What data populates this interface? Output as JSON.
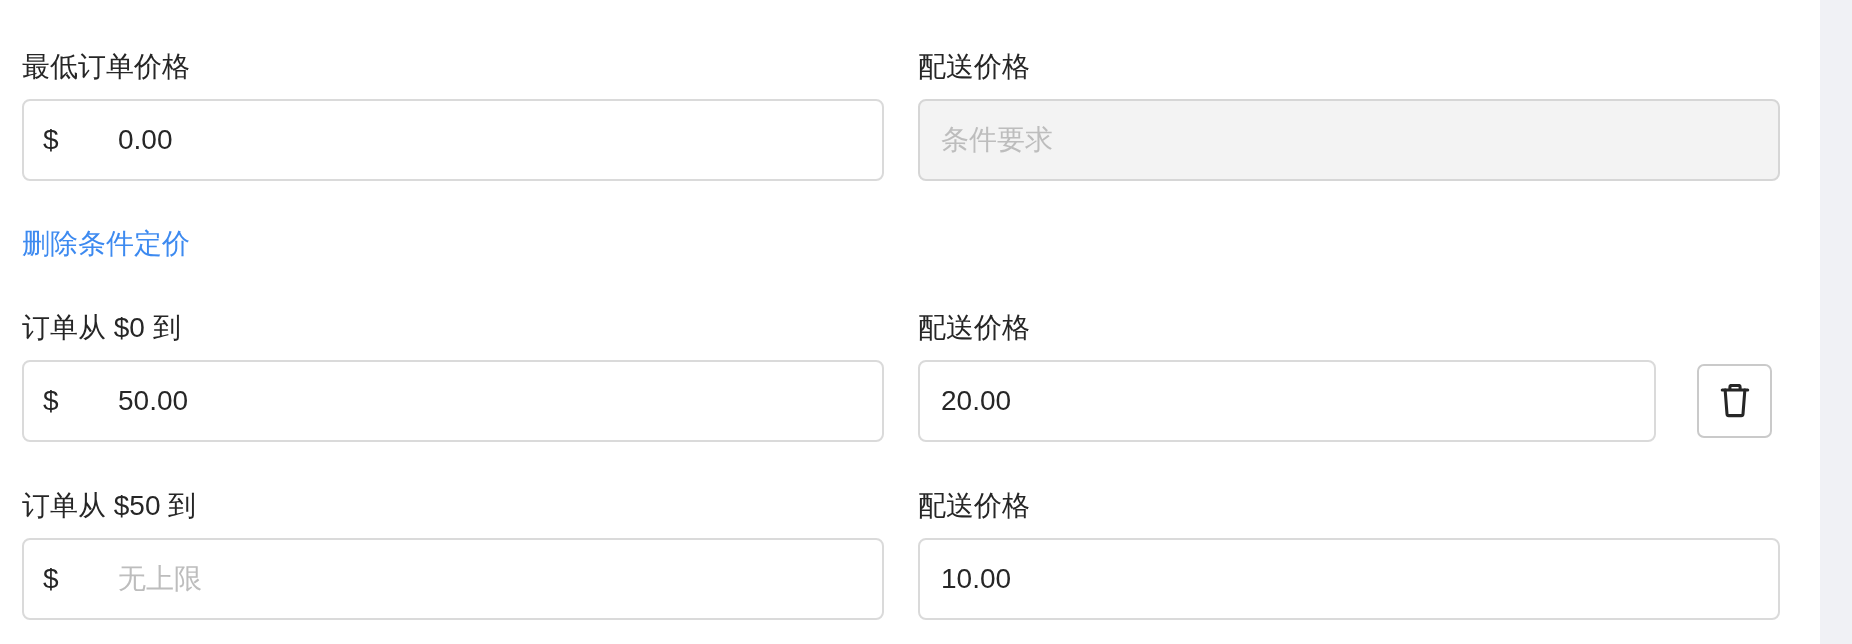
{
  "minimum_row": {
    "order": {
      "label": "最低订单价格",
      "currency": "$",
      "value": "0.00"
    },
    "shipping": {
      "label": "配送价格",
      "placeholder": "条件要求",
      "disabled": true
    },
    "delete_button": false
  },
  "remove_link": "删除条件定价",
  "tiers": [
    {
      "order": {
        "label": "订单从 $0 到",
        "currency": "$",
        "value": "50.00"
      },
      "shipping": {
        "label": "配送价格",
        "value": "20.00",
        "disabled": false
      },
      "delete_button": true
    },
    {
      "order": {
        "label": "订单从 $50 到",
        "currency": "$",
        "placeholder": "无上限"
      },
      "shipping": {
        "label": "配送价格",
        "value": "10.00",
        "disabled": false
      },
      "delete_button": false
    }
  ]
}
